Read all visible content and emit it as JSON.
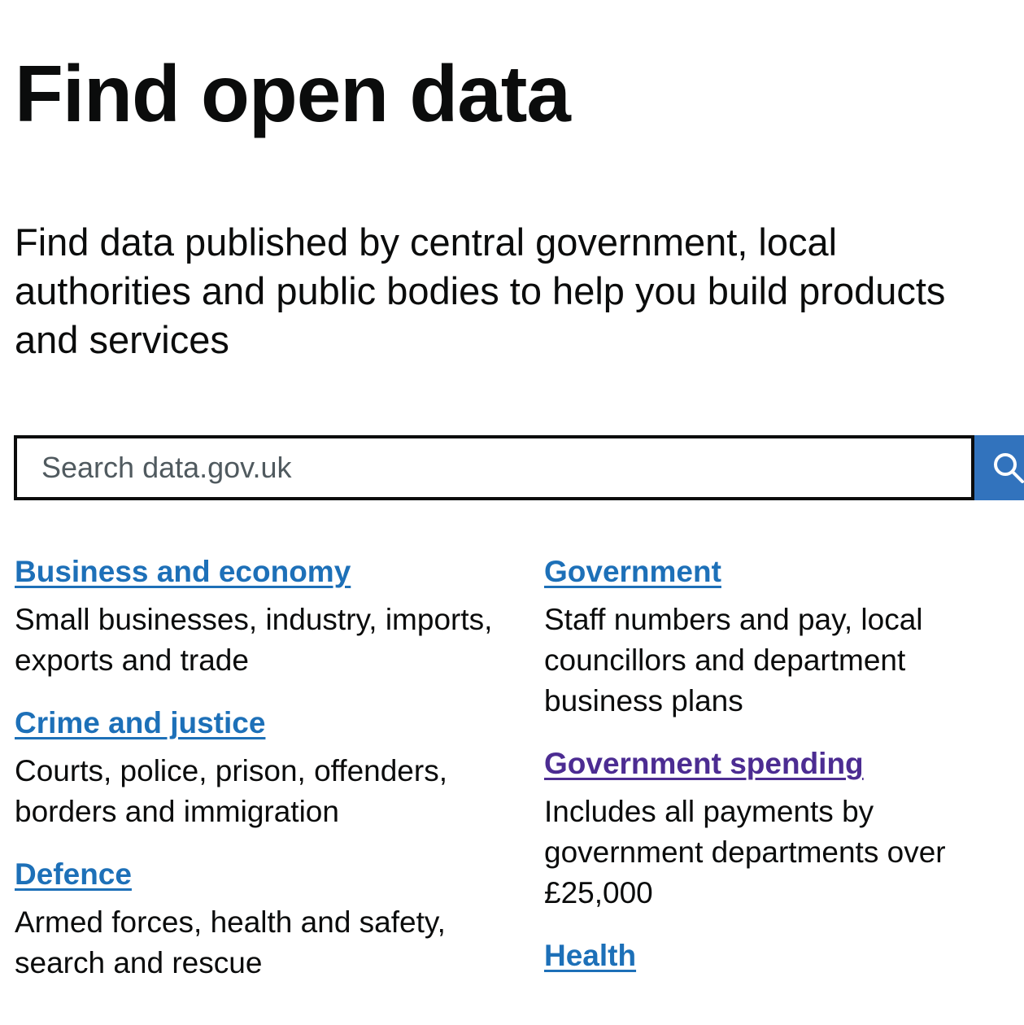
{
  "page": {
    "title": "Find open data",
    "lead": "Find data published by central government, local authorities and public bodies to help you build products and services"
  },
  "search": {
    "placeholder": "Search data.gov.uk",
    "value": "",
    "button_icon": "search-icon",
    "button_color": "#3273bd"
  },
  "colors": {
    "link": "#1d70b8",
    "link_visited": "#4c2c92",
    "text": "#0b0c0c"
  },
  "topics_left": [
    {
      "label": "Business and economy",
      "description": "Small businesses, industry, imports, exports and trade",
      "visited": false
    },
    {
      "label": "Crime and justice",
      "description": "Courts, police, prison, offenders, borders and immigration",
      "visited": false
    },
    {
      "label": "Defence",
      "description": "Armed forces, health and safety, search and rescue",
      "visited": false
    }
  ],
  "topics_right": [
    {
      "label": "Government",
      "description": "Staff numbers and pay, local councillors and department business plans",
      "visited": false
    },
    {
      "label": "Government spending",
      "description": "Includes all payments by government departments over £25,000",
      "visited": true
    },
    {
      "label": "Health",
      "description": "",
      "visited": false
    }
  ]
}
